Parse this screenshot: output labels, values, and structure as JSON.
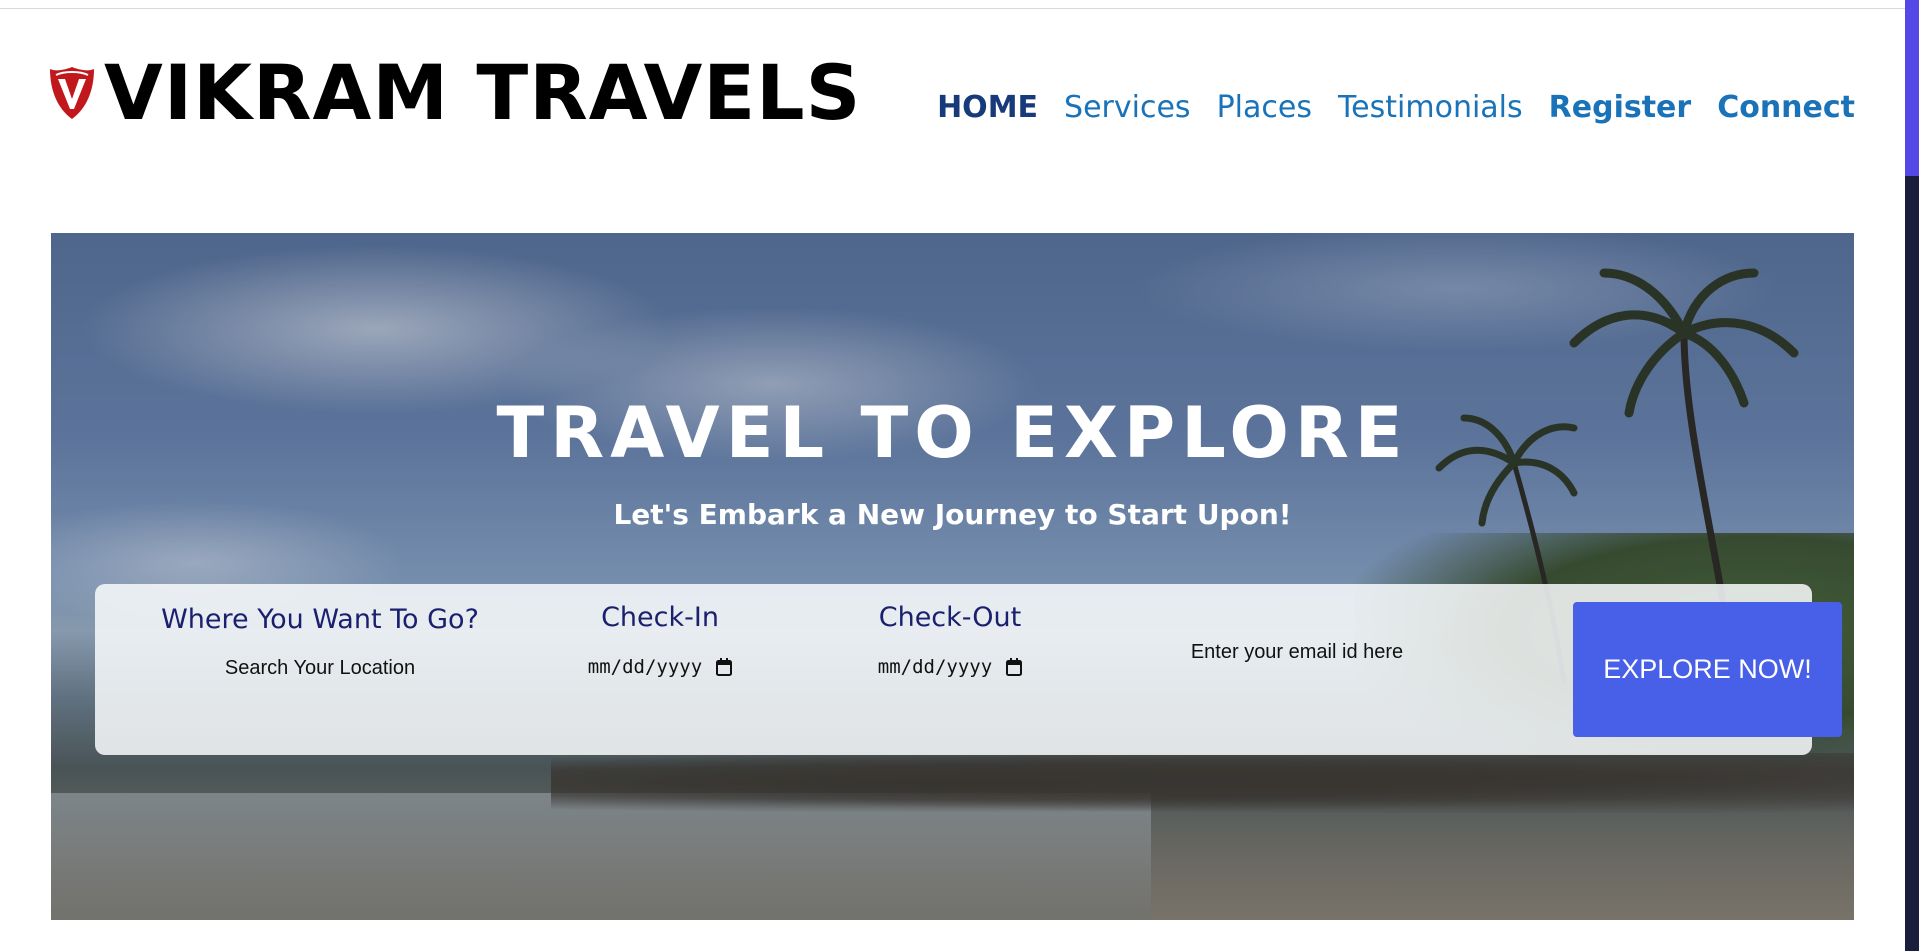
{
  "brand": {
    "name": "VIKRAM TRAVELS",
    "logo_icon": "shield-v-icon",
    "logo_color": "#c0181c"
  },
  "nav": {
    "items": [
      {
        "label": "HOME",
        "active": true
      },
      {
        "label": "Services"
      },
      {
        "label": "Places"
      },
      {
        "label": "Testimonials"
      },
      {
        "label": "Register"
      },
      {
        "label": "Connect"
      }
    ],
    "active_color": "#163a7a",
    "link_color": "#1a73b8"
  },
  "hero": {
    "title": "TRAVEL TO EXPLORE",
    "subtitle": "Let's Embark a New Journey to Start Upon!"
  },
  "search": {
    "location_label": "Where You Want To Go?",
    "location_placeholder": "Search Your Location",
    "checkin_label": "Check-In",
    "checkin_placeholder": "mm/dd/yyyy",
    "checkout_label": "Check-Out",
    "checkout_placeholder": "mm/dd/yyyy",
    "email_placeholder": "Enter your email id here",
    "button_label": "EXPLORE NOW!",
    "button_color": "#485fe8"
  }
}
